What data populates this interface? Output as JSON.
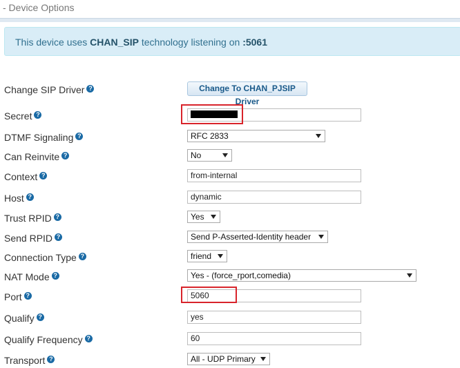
{
  "section": {
    "title": "- Device Options"
  },
  "info": {
    "prefix": "This device uses ",
    "tech": "CHAN_SIP",
    "middle": " technology listening on ",
    "port": ":5061"
  },
  "help_icon": "question-circle-icon",
  "colors": {
    "highlight": "#d8232a",
    "info_bg": "#d9edf7",
    "help": "#1a6aa5"
  },
  "fields": {
    "change_driver": {
      "label": "Change SIP Driver",
      "button": "Change To CHAN_PJSIP Driver"
    },
    "secret": {
      "label": "Secret",
      "value": ""
    },
    "dtmf": {
      "label": "DTMF Signaling",
      "value": "RFC 2833"
    },
    "reinvite": {
      "label": "Can Reinvite",
      "value": "No"
    },
    "context": {
      "label": "Context",
      "value": "from-internal"
    },
    "host": {
      "label": "Host",
      "value": "dynamic"
    },
    "trust_rpid": {
      "label": "Trust RPID",
      "value": "Yes"
    },
    "send_rpid": {
      "label": "Send RPID",
      "value": "Send P-Asserted-Identity header"
    },
    "connection_type": {
      "label": "Connection Type",
      "value": "friend"
    },
    "nat_mode": {
      "label": "NAT Mode",
      "value": "Yes - (force_rport,comedia)"
    },
    "port": {
      "label": "Port",
      "value": "5060"
    },
    "qualify": {
      "label": "Qualify",
      "value": "yes"
    },
    "qualify_freq": {
      "label": "Qualify Frequency",
      "value": "60"
    },
    "transport": {
      "label": "Transport",
      "value": "All - UDP Primary"
    }
  }
}
